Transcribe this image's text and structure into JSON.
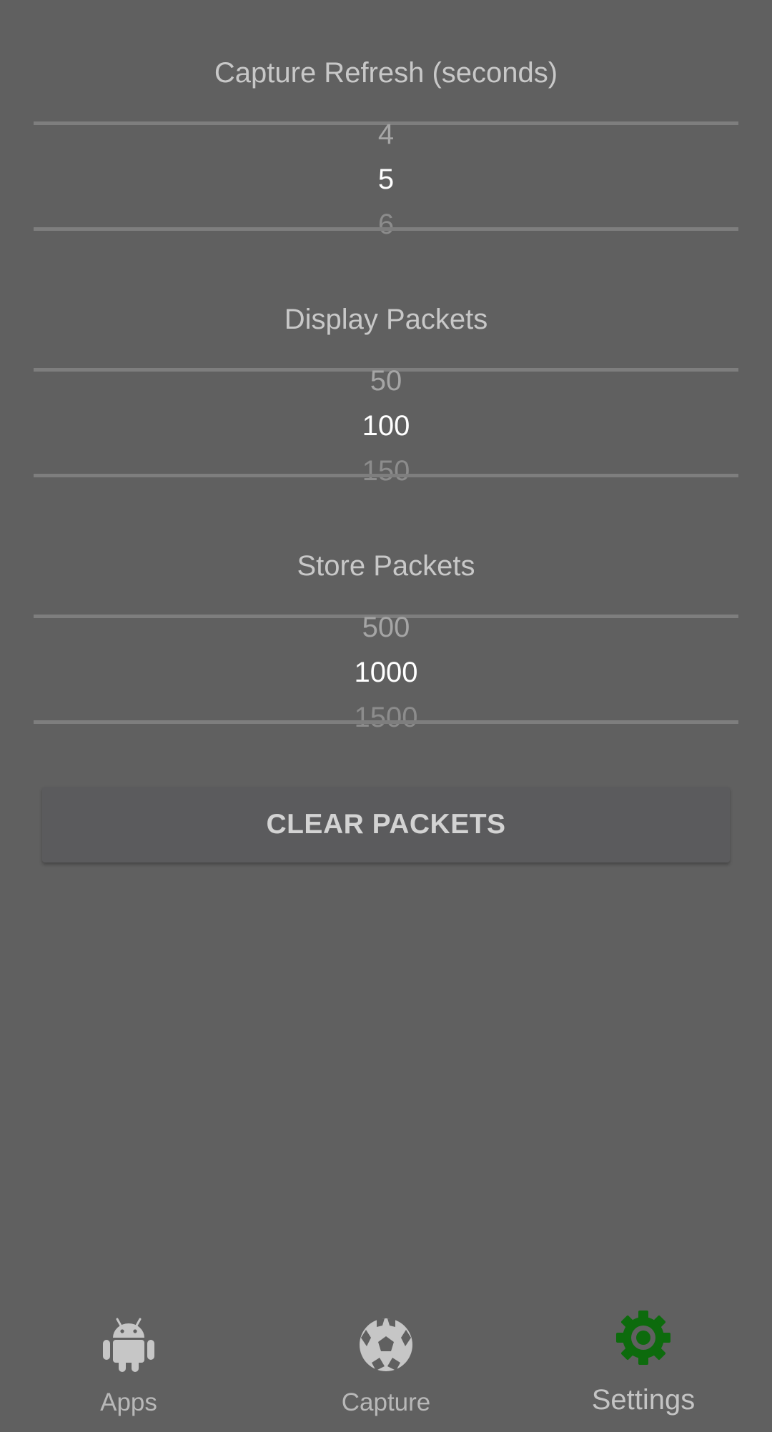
{
  "capture_refresh": {
    "title": "Capture Refresh (seconds)",
    "prev": "4",
    "current": "5",
    "next": "6"
  },
  "display_packets": {
    "title": "Display Packets",
    "prev": "50",
    "current": "100",
    "next": "150"
  },
  "store_packets": {
    "title": "Store Packets",
    "prev": "500",
    "current": "1000",
    "next": "1500"
  },
  "clear_button": {
    "label": "CLEAR PACKETS"
  },
  "bottom_nav": {
    "items": [
      {
        "label": "Apps",
        "icon": "android-icon",
        "active": false
      },
      {
        "label": "Capture",
        "icon": "soccer-ball-icon",
        "active": false
      },
      {
        "label": "Settings",
        "icon": "gear-icon",
        "active": true
      }
    ]
  },
  "colors": {
    "background": "#606060",
    "active_tab": "#0d6b0d",
    "inactive_icon": "#c6c6c6",
    "selected_value": "#ffffff"
  }
}
